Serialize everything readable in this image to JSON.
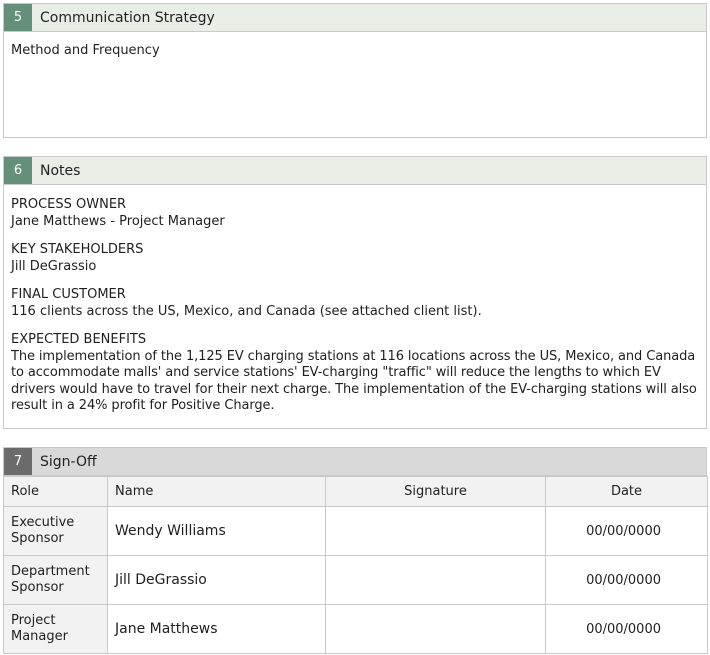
{
  "communication": {
    "number": "5",
    "title": "Communication Strategy",
    "body": "Method and Frequency"
  },
  "notes": {
    "number": "6",
    "title": "Notes",
    "blocks": [
      {
        "heading": "PROCESS OWNER",
        "text": "Jane Matthews - Project Manager"
      },
      {
        "heading": "KEY STAKEHOLDERS",
        "text": "Jill DeGrassio"
      },
      {
        "heading": "FINAL CUSTOMER",
        "text": "116  clients across the US, Mexico, and Canada (see attached client list)."
      },
      {
        "heading": "EXPECTED BENEFITS",
        "text": "The implementation of the 1,125 EV charging stations at 116  locations across the US, Mexico, and Canada to accommodate malls' and service stations' EV-charging \"traffic\" will reduce the lengths to which EV drivers would have to travel for their next charge. The implementation of the EV-charging stations will also result in a 24% profit for Positive Charge."
      }
    ]
  },
  "signoff": {
    "number": "7",
    "title": "Sign-Off",
    "columns": [
      "Role",
      "Name",
      "Signature",
      "Date"
    ],
    "rows": [
      {
        "role": "Executive Sponsor",
        "name": "Wendy Williams",
        "signature": "",
        "date": "00/00/0000"
      },
      {
        "role": "Department Sponsor",
        "name": "Jill DeGrassio",
        "signature": "",
        "date": "00/00/0000"
      },
      {
        "role": "Project Manager",
        "name": "Jane Matthews",
        "signature": "",
        "date": "00/00/0000"
      }
    ]
  }
}
